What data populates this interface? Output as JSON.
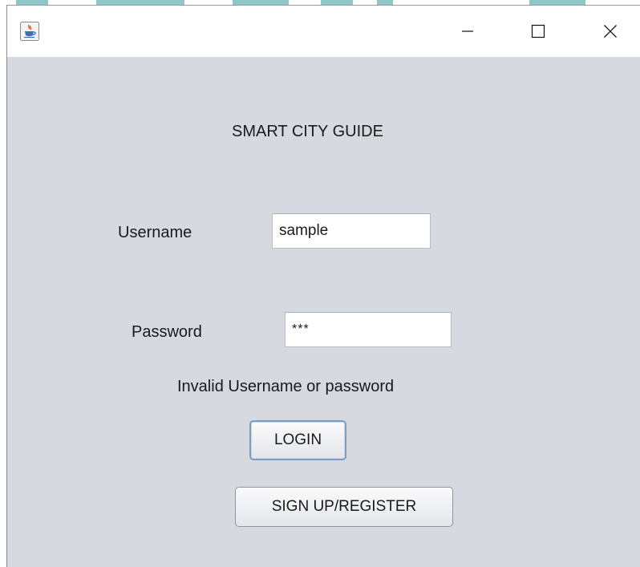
{
  "window": {
    "title": "",
    "app_icon": "java-cup-icon",
    "controls": {
      "minimize": "—",
      "maximize": "☐",
      "close": "✕"
    }
  },
  "form": {
    "title": "SMART CITY GUIDE",
    "username_label": "Username",
    "username_value": "sample",
    "password_label": "Password",
    "password_value": "***",
    "error_message": "Invalid Username or password",
    "login_button": "LOGIN",
    "signup_button": "SIGN UP/REGISTER"
  },
  "colors": {
    "background": "#d6d9e0",
    "titlebar": "#ffffff",
    "focus_border": "#7d9ec0"
  }
}
